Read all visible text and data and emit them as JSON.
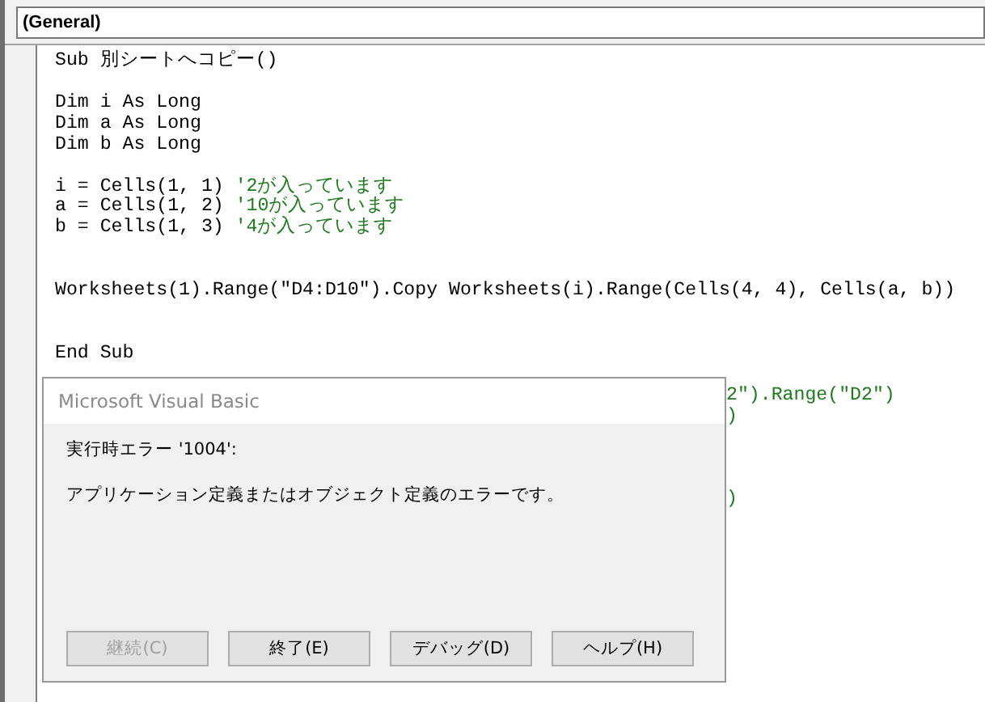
{
  "procedure_combo": {
    "value": "(General)"
  },
  "code_lines": [
    {
      "kind": "code",
      "code": "Sub 別シートへコピー()"
    },
    {
      "kind": "blank"
    },
    {
      "kind": "code",
      "code": "Dim i As Long"
    },
    {
      "kind": "code",
      "code": "Dim a As Long"
    },
    {
      "kind": "code",
      "code": "Dim b As Long"
    },
    {
      "kind": "blank"
    },
    {
      "kind": "code",
      "code": "i = Cells(1, 1) ",
      "comment": "'2が入っています"
    },
    {
      "kind": "code",
      "code": "a = Cells(1, 2) ",
      "comment": "'10が入っています"
    },
    {
      "kind": "code",
      "code": "b = Cells(1, 3) ",
      "comment": "'4が入っています"
    },
    {
      "kind": "blank"
    },
    {
      "kind": "blank"
    },
    {
      "kind": "code",
      "code": "Worksheets(1).Range(\"D4:D10\").Copy Worksheets(i).Range(Cells(4, 4), Cells(a, b))"
    },
    {
      "kind": "blank"
    },
    {
      "kind": "blank"
    },
    {
      "kind": "code",
      "code": "End Sub"
    },
    {
      "kind": "blank"
    },
    {
      "kind": "fragment",
      "code": "2\").Range(\"D2\")"
    },
    {
      "kind": "fragment",
      "code": ")"
    },
    {
      "kind": "blank"
    },
    {
      "kind": "blank"
    },
    {
      "kind": "blank"
    },
    {
      "kind": "fragment",
      "code": ")"
    }
  ],
  "dialog": {
    "title": "Microsoft Visual Basic",
    "error_code": "実行時エラー '1004':",
    "message": "アプリケーション定義またはオブジェクト定義のエラーです。",
    "buttons": [
      {
        "label": "継続(C)",
        "disabled": true
      },
      {
        "label": "終了(E)",
        "disabled": false
      },
      {
        "label": "デバッグ(D)",
        "disabled": false
      },
      {
        "label": "ヘルプ(H)",
        "disabled": false
      }
    ]
  }
}
